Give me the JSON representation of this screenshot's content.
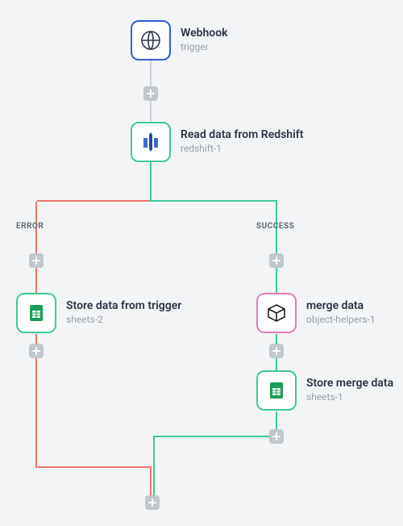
{
  "nodes": {
    "webhook": {
      "title": "Webhook",
      "subtitle": "trigger"
    },
    "redshift": {
      "title": "Read data from Redshift",
      "subtitle": "redshift-1"
    },
    "sheets2": {
      "title": "Store data from trigger",
      "subtitle": "sheets-2"
    },
    "merge": {
      "title": "merge data",
      "subtitle": "object-helpers-1"
    },
    "sheets1": {
      "title": "Store merge data",
      "subtitle": "sheets-1"
    }
  },
  "branches": {
    "error": {
      "label": "ERROR"
    },
    "success": {
      "label": "SUCCESS"
    }
  },
  "colors": {
    "error": "#e6756e",
    "success": "#3fc99a",
    "neutral": "#cfd3d9"
  }
}
